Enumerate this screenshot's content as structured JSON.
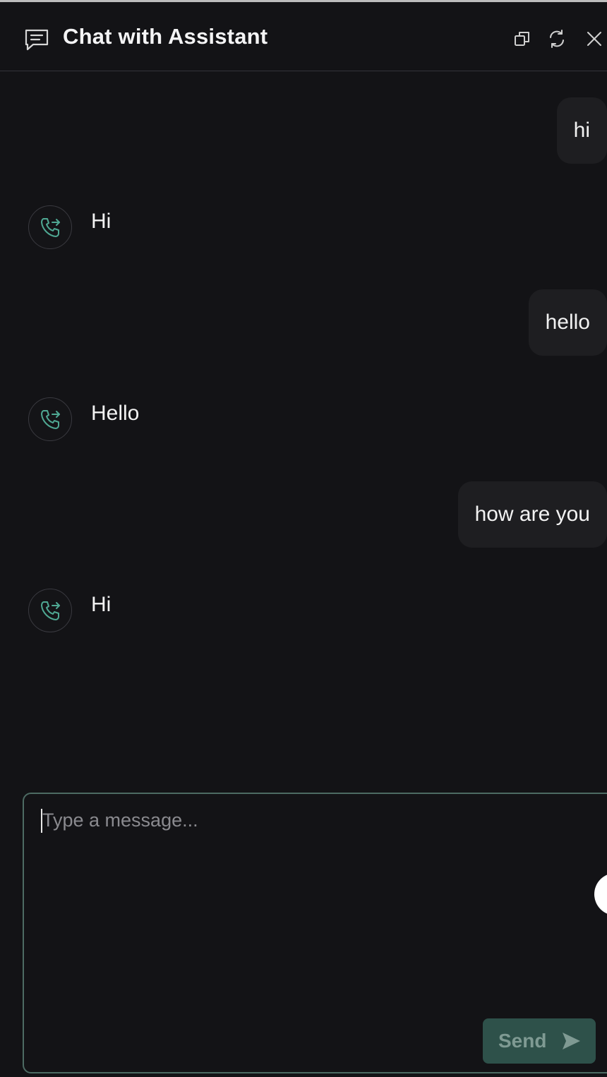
{
  "header": {
    "title": "Chat with Assistant",
    "icons": {
      "chat": "chat-bubble-icon",
      "popout": "popout-icon",
      "refresh": "refresh-icon",
      "close": "close-icon"
    }
  },
  "messages": [
    {
      "role": "user",
      "text": "hi"
    },
    {
      "role": "assistant",
      "text": "Hi",
      "avatar_icon": "phone-transfer-icon"
    },
    {
      "role": "user",
      "text": "hello"
    },
    {
      "role": "assistant",
      "text": "Hello",
      "avatar_icon": "phone-transfer-icon"
    },
    {
      "role": "user",
      "text": "how are you"
    },
    {
      "role": "assistant",
      "text": "Hi",
      "avatar_icon": "phone-transfer-icon"
    }
  ],
  "composer": {
    "placeholder": "Type a message...",
    "value": "",
    "send_label": "Send",
    "send_icon": "send-arrow-icon"
  },
  "colors": {
    "background": "#131316",
    "user_bubble": "#1e1e21",
    "accent": "#4fa893",
    "send_button": "#2e514a",
    "composer_border": "#4d6b63"
  }
}
